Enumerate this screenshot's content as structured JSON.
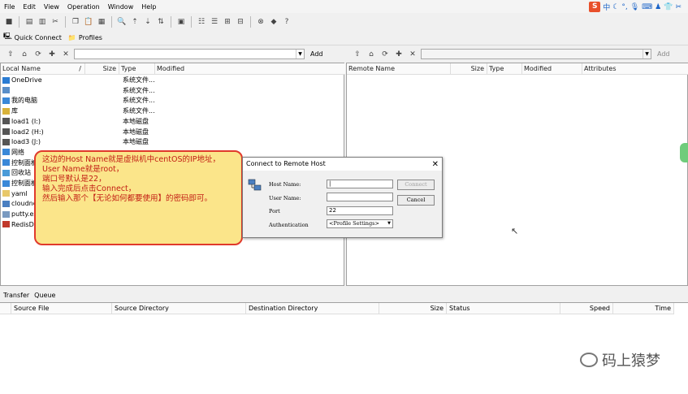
{
  "menubar": {
    "items": [
      "File",
      "Edit",
      "View",
      "Operation",
      "Window",
      "Help"
    ]
  },
  "quickbar": {
    "quick_connect": "Quick Connect",
    "profiles": "Profiles"
  },
  "local": {
    "add_label": "Add",
    "columns": {
      "name": "Local Name",
      "sep": "/",
      "size": "Size",
      "type": "Type",
      "modified": "Modified"
    },
    "rows": [
      {
        "name": "OneDrive",
        "type": "系统文件..."
      },
      {
        "name": "",
        "type": "系统文件..."
      },
      {
        "name": "我的电脑",
        "type": "系统文件..."
      },
      {
        "name": "库",
        "type": "系统文件..."
      },
      {
        "name": "load1 (I:)",
        "type": "本地磁盘"
      },
      {
        "name": "load2 (H:)",
        "type": "本地磁盘"
      },
      {
        "name": "load3 (J:)",
        "type": "本地磁盘"
      },
      {
        "name": "网络",
        "type": ""
      },
      {
        "name": "控制面板",
        "type": ""
      },
      {
        "name": "回收站",
        "type": ""
      },
      {
        "name": "控制面板",
        "type": ""
      },
      {
        "name": "yaml",
        "type": ""
      },
      {
        "name": "cloudnot",
        "type": ""
      },
      {
        "name": "putty.exe",
        "type": ""
      },
      {
        "name": "RedisDes",
        "type": ""
      }
    ]
  },
  "remote": {
    "add_label": "Add",
    "columns": {
      "name": "Remote Name",
      "size": "Size",
      "type": "Type",
      "modified": "Modified",
      "attributes": "Attributes"
    }
  },
  "callout": {
    "lines": [
      "这边的Host Name就是虚拟机中centOS的IP地址，",
      "User Name就是root，",
      "端口号默认是22，",
      "输入完成后点击Connect，",
      "然后输入那个【无论如何都要使用】的密码即可。"
    ]
  },
  "dialog": {
    "title": "Connect to Remote Host",
    "host_label": "Host Name:",
    "user_label": "User Name:",
    "port_label": "Port",
    "port_value": "22",
    "auth_label": "Authentication",
    "auth_value": "<Profile Settings>",
    "connect": "Connect",
    "cancel": "Cancel"
  },
  "transfer": {
    "tabs": [
      "Transfer",
      "Queue"
    ],
    "columns": {
      "source_file": "Source File",
      "source_dir": "Source Directory",
      "dest_dir": "Destination Directory",
      "size": "Size",
      "status": "Status",
      "speed": "Speed",
      "time": "Time"
    }
  },
  "ime": {
    "logo": "S",
    "lang": "中"
  },
  "watermark": {
    "text": "码上猿梦"
  },
  "colors": {
    "callout_bg": "#fbe58a",
    "callout_border": "#e03a2c",
    "callout_text": "#c21d14"
  }
}
